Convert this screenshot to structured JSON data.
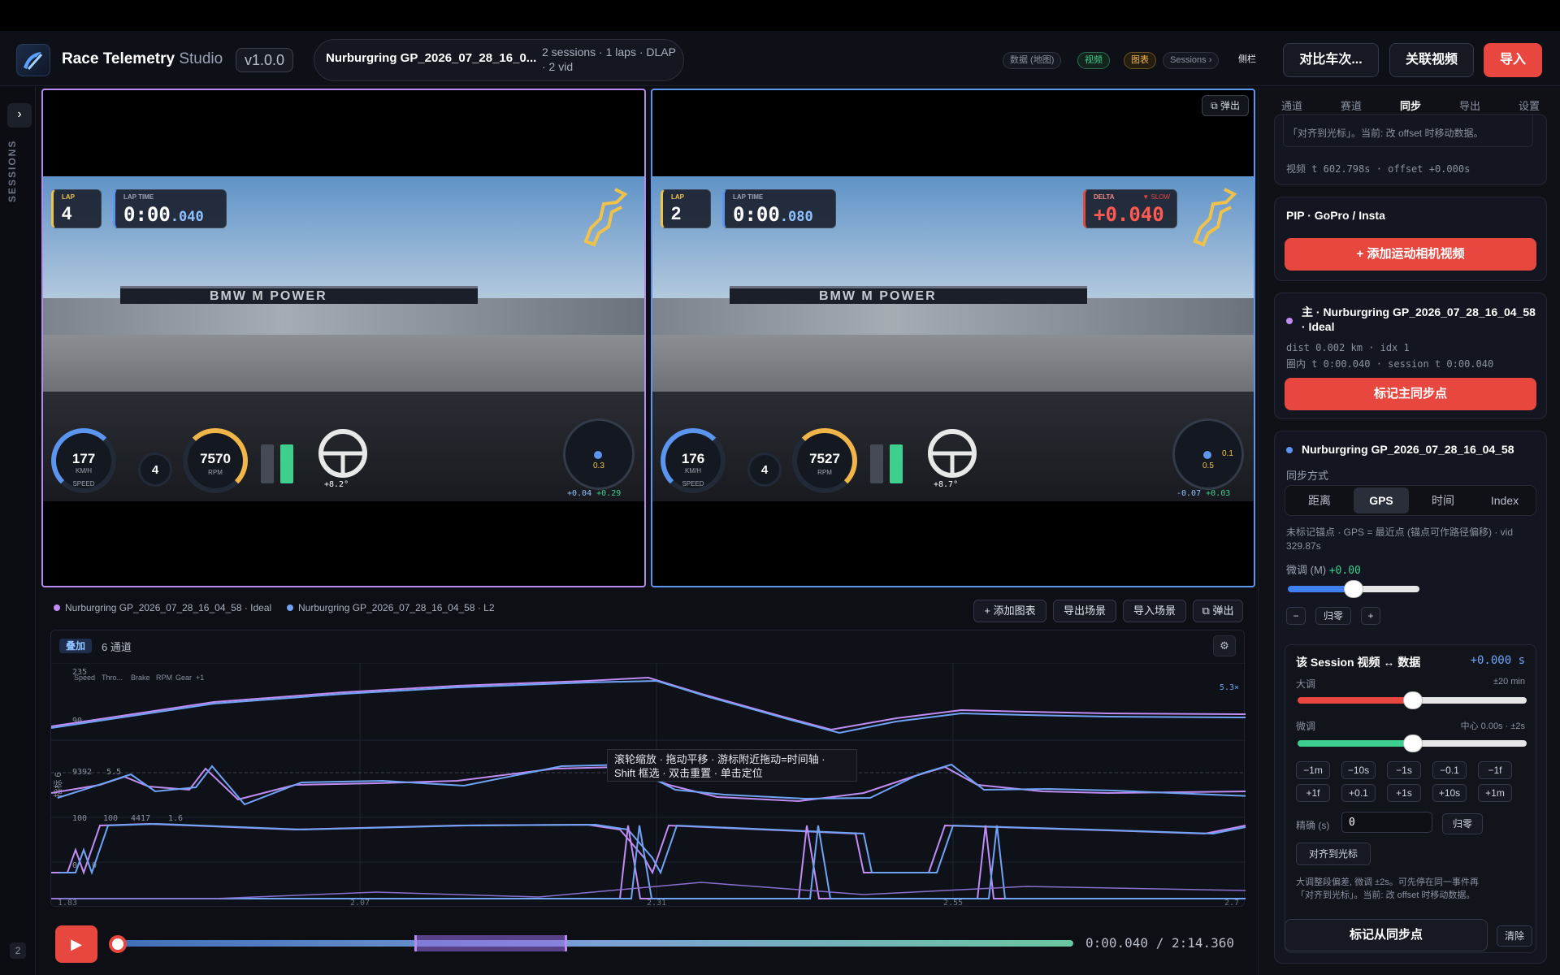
{
  "app": {
    "name": "Race Telemetry",
    "name_suffix": "Studio",
    "version": "v1.0.0"
  },
  "session": {
    "name": "Nurburgring GP_2026_07_28_16_0...",
    "info": "2 sessions · 1 laps · DLAP · 2 vid"
  },
  "nav": {
    "chips": [
      "数据 (地图)",
      "视频",
      "图表",
      "Sessions ›",
      "侧栏"
    ],
    "compare": "对比车次...",
    "link_video": "关联视频",
    "import": "导入"
  },
  "rail": {
    "label": "SESSIONS",
    "count": "2",
    "toggle": "›"
  },
  "video1": {
    "lap_label": "LAP",
    "lap": "4",
    "laptime_label": "LAP TIME",
    "laptime": "0:00",
    "laptime_ms": ".040",
    "speed": "177",
    "speed_unit": "KM/H",
    "speed_label": "SPEED",
    "gear": "4",
    "rpm": "7570",
    "rpm_label": "RPM",
    "steer": "+8.2°",
    "g1": "+0.04",
    "g2": "+0.29",
    "g3": "0.3"
  },
  "video2": {
    "lap_label": "LAP",
    "lap": "2",
    "laptime_label": "LAP TIME",
    "laptime": "0:00",
    "laptime_ms": ".080",
    "delta_label": "DELTA",
    "delta_tag": "▼ SLOW",
    "delta": "+0.040",
    "speed": "176",
    "speed_unit": "KM/H",
    "speed_label": "SPEED",
    "gear": "4",
    "rpm": "7527",
    "rpm_label": "RPM",
    "steer": "+8.7°",
    "g1": "-0.07",
    "g2": "+0.03",
    "g3": "0.5",
    "g4": "0.1",
    "popout": "⧉ 弹出"
  },
  "video_scene": {
    "banner": "BMW  M POWER"
  },
  "chart_header": {
    "legend": [
      "Nurburgring GP_2026_07_28_16_04_58 · Ideal",
      "Nurburgring GP_2026_07_28_16_04_58 · L2"
    ],
    "add_chart": "+ 添加图表",
    "export_scene": "导出场景",
    "import_scene": "导入场景",
    "popout": "⧉ 弹出"
  },
  "chart_panel": {
    "overlay_tag": "叠加",
    "channel_count": "6 通道",
    "gear": "⚙",
    "tooltip_line1": "滚轮缩放 · 拖动平移 · 游标附近拖动=时间轴 ·",
    "tooltip_line2": "Shift 框选 · 双击重置 · 单击定位",
    "channels": [
      "Speed",
      "Thro...",
      "Brake",
      "RPM",
      "Gear",
      "+1"
    ],
    "zoom": "5.3×",
    "side_label": "指标 6",
    "y_labels": [
      "235",
      "90",
      "9392",
      "5.5",
      "100",
      "100",
      "4417",
      "1.6",
      "0",
      "0"
    ],
    "x_labels": [
      "1.83",
      "2.07",
      "2.31",
      "2.55",
      "2.7"
    ]
  },
  "chart_data": {
    "type": "line",
    "x_range": [
      1.83,
      2.8
    ],
    "series": [
      {
        "name": "Nurburgring GP_2026_07_28_16_04_58 · Ideal",
        "color": "#c08cf5"
      },
      {
        "name": "Nurburgring GP_2026_07_28_16_04_58 · L2",
        "color": "#6fa3f5"
      }
    ],
    "speed_range": [
      90,
      235
    ]
  },
  "timeline": {
    "play": "▶",
    "time": "0:00.040 / 2:14.360",
    "position": 0.0003,
    "range": [
      0.31,
      0.47
    ]
  },
  "right_tabs": [
    "通道",
    "赛道",
    "同步",
    "导出",
    "设置"
  ],
  "sync_top": {
    "text": "「对齐到光标」。当前: 改 offset 时移动数据。",
    "video_t": "视频 t 602.798s · offset +0.000s"
  },
  "pip": {
    "title": "PIP · GoPro / Insta",
    "add": "+ 添加运动相机视频"
  },
  "master": {
    "title": "主 · Nurburgring GP_2026_07_28_16_04_58 · Ideal",
    "line1": "dist 0.002 km · idx 1",
    "line2": "圈内 t 0:00.040 · session t 0:00.040",
    "mark": "标记主同步点"
  },
  "slave": {
    "title": "Nurburgring GP_2026_07_28_16_04_58",
    "mode_label": "同步方式",
    "modes": [
      "距离",
      "GPS",
      "时间",
      "Index"
    ],
    "active_mode": "GPS",
    "note": "未标记锚点 · GPS = 最近点 (锚点可作路径偏移) · vid 329.87s",
    "fine_label": "微调 (M)",
    "fine_value": "+0.00",
    "minus": "−",
    "zero": "归零",
    "plus": "+"
  },
  "session_sync": {
    "title": "Session 视频 ↔ 数据",
    "prefix": "该",
    "offset": "+0.000 s",
    "coarse_label": "大调",
    "coarse_range": "±20 min",
    "fine_label": "微调",
    "fine_range": "中心 0.00s · ±2s",
    "steps_row1": [
      "−1m",
      "−10s",
      "−1s",
      "−0.1",
      "−1f"
    ],
    "steps_row2": [
      "+1f",
      "+0.1",
      "+1s",
      "+10s",
      "+1m"
    ],
    "precise_label": "精确 (s)",
    "precise_value": "0",
    "zero": "归零",
    "align": "对齐到光标",
    "hint1": "大调整段偏差, 微调 ±2s。可先停在同一事件再",
    "hint2": "「对齐到光标」。当前: 改 offset 时移动数据。",
    "mark_slave": "标记从同步点",
    "clear": "清除"
  },
  "colors": {
    "accent": "#e8473f",
    "purple": "#b58af2",
    "blue": "#5b95f0",
    "green": "#3ccf8e"
  }
}
